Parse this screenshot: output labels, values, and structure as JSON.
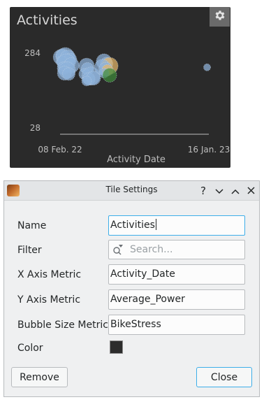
{
  "tile": {
    "title": "Activities",
    "gear_icon": "gear-icon"
  },
  "chart_data": {
    "type": "scatter",
    "subtype": "bubble",
    "xlabel": "Activity Date",
    "x_ticks": [
      "08 Feb. 22",
      "16 Jan. 23"
    ],
    "ylabel": "",
    "y_ticks": [
      "28",
      "284"
    ],
    "ylim": [
      28,
      284
    ],
    "xlim": [
      "2022-02-08",
      "2023-01-16"
    ],
    "grid": false,
    "colors": {
      "primary": "#8fb3db",
      "accent": "#e5b56a",
      "green": "#3f8a3a"
    },
    "points": [
      {
        "x": "2022-02-10",
        "y": 270,
        "size": 11,
        "color": "#8fb3db"
      },
      {
        "x": "2022-02-14",
        "y": 275,
        "size": 10,
        "color": "#8fb3db"
      },
      {
        "x": "2022-02-20",
        "y": 272,
        "size": 13,
        "color": "#8fb3db"
      },
      {
        "x": "2022-02-26",
        "y": 268,
        "size": 11,
        "color": "#8fb3db"
      },
      {
        "x": "2022-03-04",
        "y": 262,
        "size": 9,
        "color": "#8fb3db"
      },
      {
        "x": "2022-02-12",
        "y": 255,
        "size": 8,
        "color": "#8fb3db"
      },
      {
        "x": "2022-02-22",
        "y": 250,
        "size": 13,
        "color": "#8fb3db"
      },
      {
        "x": "2022-03-06",
        "y": 242,
        "size": 11,
        "color": "#8fb3db"
      },
      {
        "x": "2022-02-16",
        "y": 232,
        "size": 9,
        "color": "#8fb3db"
      },
      {
        "x": "2022-02-24",
        "y": 225,
        "size": 12,
        "color": "#8fb3db"
      },
      {
        "x": "2022-02-18",
        "y": 215,
        "size": 10,
        "color": "#8fb3db"
      },
      {
        "x": "2022-02-28",
        "y": 212,
        "size": 9,
        "color": "#8fb3db"
      },
      {
        "x": "2022-04-10",
        "y": 240,
        "size": 11,
        "color": "#8fb3db"
      },
      {
        "x": "2022-04-12",
        "y": 230,
        "size": 9,
        "color": "#8fb3db"
      },
      {
        "x": "2022-04-05",
        "y": 212,
        "size": 8,
        "color": "#8fb3db"
      },
      {
        "x": "2022-04-20",
        "y": 205,
        "size": 13,
        "color": "#8fb3db"
      },
      {
        "x": "2022-04-15",
        "y": 195,
        "size": 9,
        "color": "#8fb3db"
      },
      {
        "x": "2022-04-26",
        "y": 198,
        "size": 10,
        "color": "#8fb3db"
      },
      {
        "x": "2022-04-10",
        "y": 188,
        "size": 7,
        "color": "#8fb3db"
      },
      {
        "x": "2022-05-20",
        "y": 255,
        "size": 11,
        "color": "#8fb3db"
      },
      {
        "x": "2022-05-26",
        "y": 248,
        "size": 9,
        "color": "#8fb3db"
      },
      {
        "x": "2022-06-02",
        "y": 240,
        "size": 12,
        "color": "#e5b56a"
      },
      {
        "x": "2022-05-16",
        "y": 236,
        "size": 11,
        "color": "#8fb3db"
      },
      {
        "x": "2022-05-24",
        "y": 228,
        "size": 10,
        "color": "#8fb3db"
      },
      {
        "x": "2022-05-28",
        "y": 225,
        "size": 8,
        "color": "#e5b56a"
      },
      {
        "x": "2022-05-20",
        "y": 215,
        "size": 7,
        "color": "#8fb3db"
      },
      {
        "x": "2022-06-02",
        "y": 208,
        "size": 10,
        "color": "#3f8a3a"
      },
      {
        "x": "2023-01-12",
        "y": 235,
        "size": 5,
        "color": "#8fb3db"
      }
    ]
  },
  "dialog": {
    "title": "Tile Settings",
    "help_label": "?",
    "minimize_label": "⌄",
    "maximize_label": "⌃",
    "close_label": "✕",
    "app_icon": "app-icon",
    "fields": {
      "name": {
        "label": "Name",
        "value": "Activities"
      },
      "filter": {
        "label": "Filter",
        "placeholder": "Search..."
      },
      "x_axis": {
        "label": "X Axis Metric",
        "value": "Activity_Date"
      },
      "y_axis": {
        "label": "Y Axis Metric",
        "value": "Average_Power"
      },
      "bubble_size": {
        "label": "Bubble Size Metric",
        "value": "BikeStress"
      },
      "color": {
        "label": "Color",
        "value": "#2c2c2c"
      }
    },
    "buttons": {
      "remove": "Remove",
      "close": "Close"
    }
  }
}
